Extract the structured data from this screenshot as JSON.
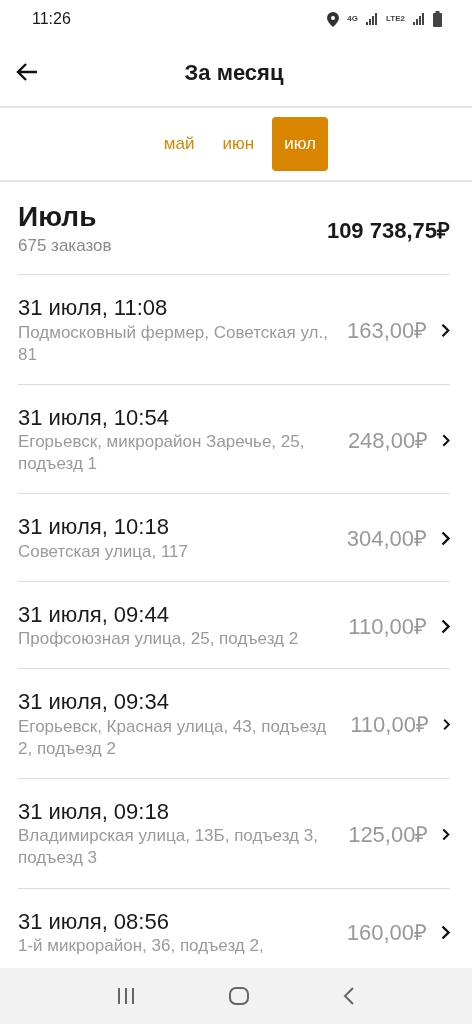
{
  "status_bar": {
    "time": "11:26",
    "network": "4G",
    "network_2": "LTE2"
  },
  "header": {
    "title": "За месяц"
  },
  "tabs": [
    {
      "label": "май",
      "selected": false
    },
    {
      "label": "июн",
      "selected": false
    },
    {
      "label": "июл",
      "selected": true
    }
  ],
  "summary": {
    "month": "Июль",
    "orders": "675 заказов",
    "total": "109 738,75₽"
  },
  "orders": [
    {
      "date": "31 июля, 11:08",
      "address": "Подмосковный фермер, Советская ул., 81",
      "price": "163,00₽"
    },
    {
      "date": "31 июля, 10:54",
      "address": "Егорьевск, микрорайон Заречье, 25, подъезд 1",
      "price": "248,00₽"
    },
    {
      "date": "31 июля, 10:18",
      "address": "Советская улица, 117",
      "price": "304,00₽"
    },
    {
      "date": "31 июля, 09:44",
      "address": "Профсоюзная улица, 25, подъезд 2",
      "price": "110,00₽"
    },
    {
      "date": "31 июля, 09:34",
      "address": "Егорьевск, Красная улица, 43, подъезд 2, подъезд 2",
      "price": "110,00₽"
    },
    {
      "date": "31 июля, 09:18",
      "address": "Владимирская улица, 13Б, подъезд 3, подъезд 3",
      "price": "125,00₽"
    },
    {
      "date": "31 июля, 08:56",
      "address": "1-й микрорайон, 36, подъезд 2,",
      "price": "160,00₽"
    }
  ]
}
